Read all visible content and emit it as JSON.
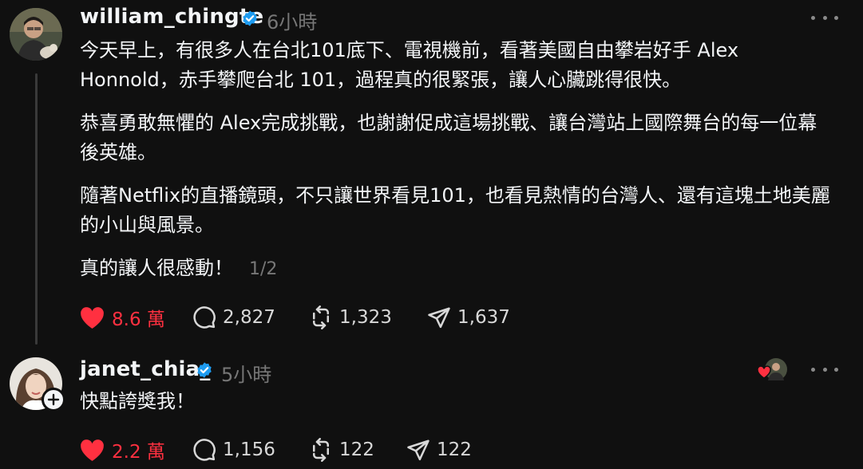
{
  "post": {
    "username": "william_chingte",
    "time": "6小時",
    "paragraphs": [
      "今天早上，有很多人在台北101底下、電視機前，看著美國自由攀岩好手 Alex Honnold，赤手攀爬台北 101，過程真的很緊張，讓人心臟跳得很快。",
      "恭喜勇敢無懼的 Alex完成挑戰，也謝謝促成這場挑戰、讓台灣站上國際舞台的每一位幕後英雄。",
      "隨著Netflix的直播鏡頭，不只讓世界看見101，也看見熱情的台灣人、還有這塊土地美麗的小山與風景。",
      "真的讓人很感動！"
    ],
    "page_indicator": "1/2",
    "likes": "8.6 萬",
    "comments": "2,827",
    "reposts": "1,323",
    "shares": "1,637"
  },
  "reply": {
    "username": "janet_chia_",
    "time": "5小時",
    "text": "快點誇獎我！",
    "likes": "2.2 萬",
    "comments": "1,156",
    "reposts": "122",
    "shares": "122"
  },
  "colors": {
    "background": "#101010",
    "text": "#f3f5f7",
    "muted": "#777777",
    "like": "#ff3040",
    "verified": "#1d9bf0"
  },
  "icons": [
    "heart-icon",
    "comment-icon",
    "repost-icon",
    "share-icon",
    "verified-icon",
    "more-icon",
    "plus-icon"
  ]
}
